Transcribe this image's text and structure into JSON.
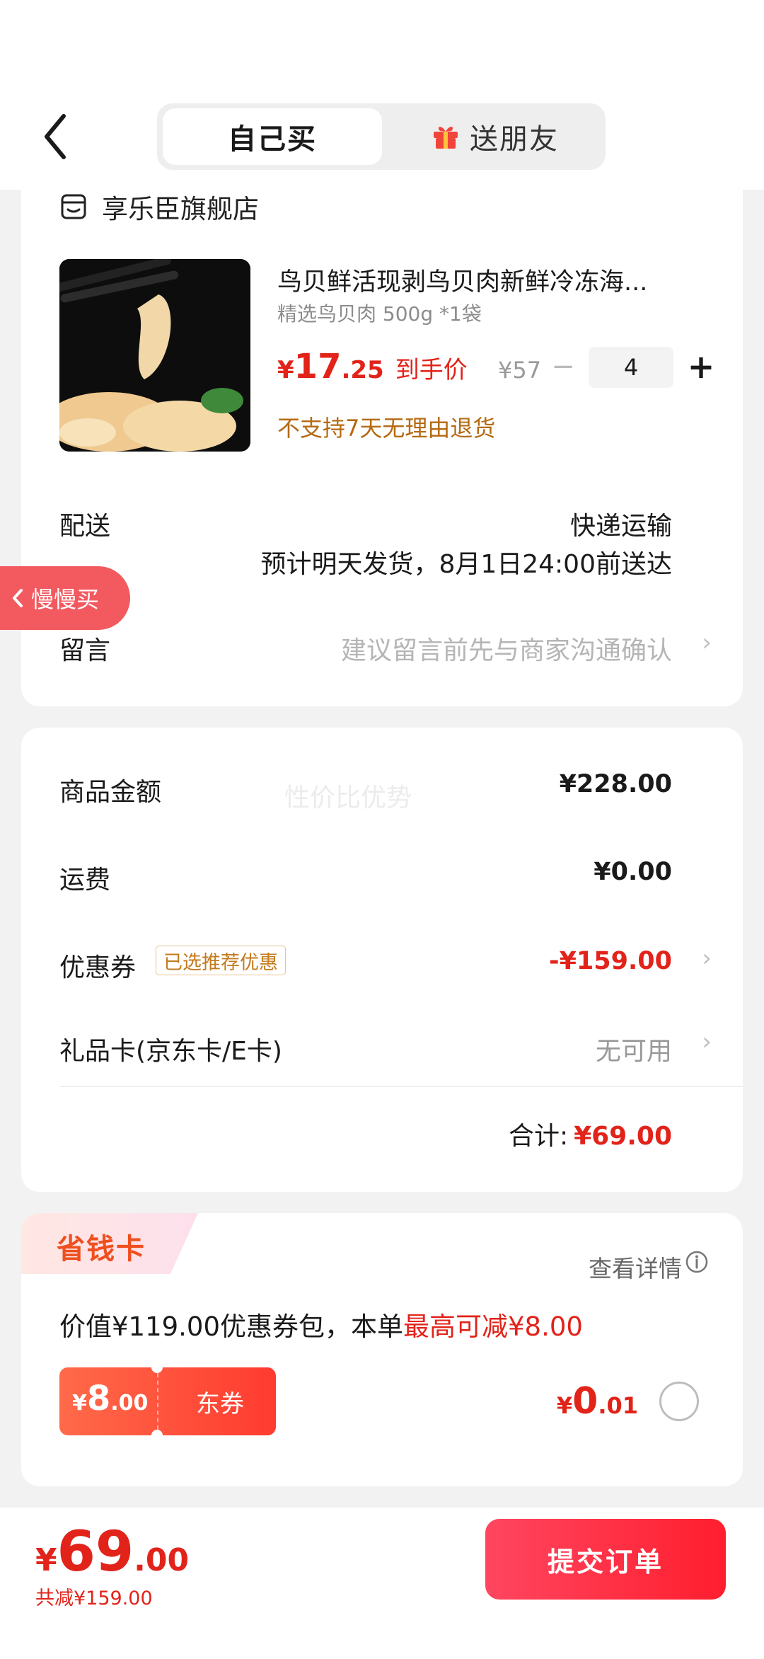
{
  "header": {
    "tab_self": "自己买",
    "tab_gift": "送朋友"
  },
  "store": {
    "name": "享乐臣旗舰店"
  },
  "product": {
    "title": "鸟贝鲜活现剥鸟贝肉新鲜冷冻海...",
    "spec": "精选鸟贝肉 500g *1袋",
    "price_currency": "¥",
    "price_int": "17",
    "price_dec": ".25",
    "price_label": "到手价",
    "original_price": "¥57",
    "quantity": "4",
    "minus": "−",
    "plus": "+",
    "return_policy": "不支持7天无理由退货"
  },
  "delivery": {
    "label": "配送",
    "method": "快递运输",
    "eta": "预计明天发货，8月1日24:00前送达"
  },
  "message": {
    "label": "留言",
    "placeholder": "建议留言前先与商家沟通确认"
  },
  "slow_buy": {
    "label": "慢慢买"
  },
  "price_detail": {
    "watermark": "性价比优势",
    "goods_label": "商品金额",
    "goods_value": "¥228.00",
    "shipping_label": "运费",
    "shipping_value": "¥0.00",
    "coupon_label": "优惠券",
    "coupon_tag": "已选推荐优惠",
    "coupon_value": "-¥159.00",
    "giftcard_label": "礼品卡(京东卡/E卡)",
    "giftcard_value": "无可用",
    "total_label": "合计:",
    "total_value": "¥69.00"
  },
  "save_card": {
    "title": "省钱卡",
    "detail": "查看详情",
    "desc_prefix": "价值¥119.00优惠券包，本单",
    "desc_highlight": "最高可减¥8.00",
    "voucher_currency": "¥",
    "voucher_int": "8",
    "voucher_dec": ".00",
    "voucher_label": "东券",
    "price_currency": "¥",
    "price_int": "0",
    "price_dec": ".01",
    "selected": false
  },
  "bottom_bar": {
    "currency": "¥",
    "total_int": "69",
    "total_dec": ".00",
    "saved": "共减¥159.00",
    "submit": "提交订单"
  },
  "colors": {
    "accent_red": "#e2231a",
    "coupon_orange": "#b56a12",
    "save_title": "#ef4f1f",
    "submit_gradient_start": "#ff4660",
    "submit_gradient_end": "#ff1e2e"
  }
}
